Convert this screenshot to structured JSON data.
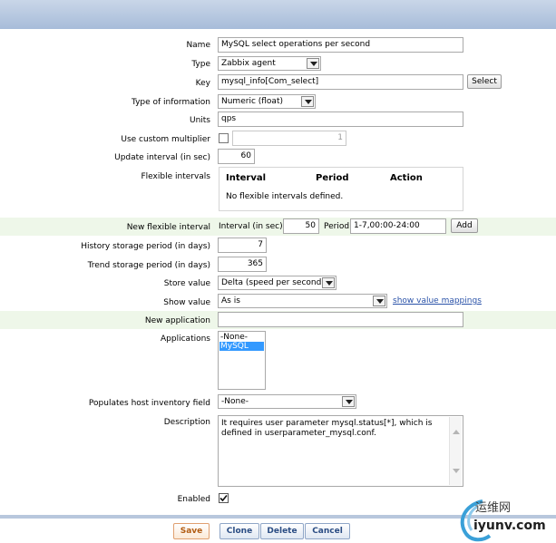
{
  "form": {
    "name": {
      "label": "Name",
      "value": "MySQL select operations per second"
    },
    "type": {
      "label": "Type",
      "value": "Zabbix agent"
    },
    "key": {
      "label": "Key",
      "value": "mysql_info[Com_select]",
      "button": "Select"
    },
    "type_of_information": {
      "label": "Type of information",
      "value": "Numeric (float)"
    },
    "units": {
      "label": "Units",
      "value": "qps"
    },
    "custom_multiplier": {
      "label": "Use custom multiplier",
      "value": "1",
      "checked": false
    },
    "update_interval": {
      "label": "Update interval (in sec)",
      "value": "60"
    },
    "flexible_intervals": {
      "label": "Flexible intervals",
      "columns": [
        "Interval",
        "Period",
        "Action"
      ],
      "empty_text": "No flexible intervals defined."
    },
    "new_flexible_interval": {
      "label": "New flexible interval",
      "interval_label": "Interval (in sec)",
      "interval_value": "50",
      "period_label": "Period",
      "period_value": "1-7,00:00-24:00",
      "add_button": "Add"
    },
    "history": {
      "label": "History storage period (in days)",
      "value": "7"
    },
    "trends": {
      "label": "Trend storage period (in days)",
      "value": "365"
    },
    "store_value": {
      "label": "Store value",
      "value": "Delta (speed per second)"
    },
    "show_value": {
      "label": "Show value",
      "value": "As is",
      "link": "show value mappings"
    },
    "new_application": {
      "label": "New application",
      "value": ""
    },
    "applications": {
      "label": "Applications",
      "options": [
        "-None-",
        "MySQL"
      ],
      "selected": "MySQL"
    },
    "inventory": {
      "label": "Populates host inventory field",
      "value": "-None-"
    },
    "description": {
      "label": "Description",
      "value": "It requires user parameter mysql.status[*], which is defined in userparameter_mysql.conf."
    },
    "enabled": {
      "label": "Enabled",
      "checked": true
    }
  },
  "buttons": {
    "save": "Save",
    "clone": "Clone",
    "delete": "Delete",
    "cancel": "Cancel"
  },
  "watermark": {
    "cn": "运维网",
    "site": "iyunv.com"
  },
  "colors": {
    "header": "#a7bcd9",
    "band": "#eef7e9",
    "link": "#2a52a8",
    "selection": "#3399ff"
  }
}
